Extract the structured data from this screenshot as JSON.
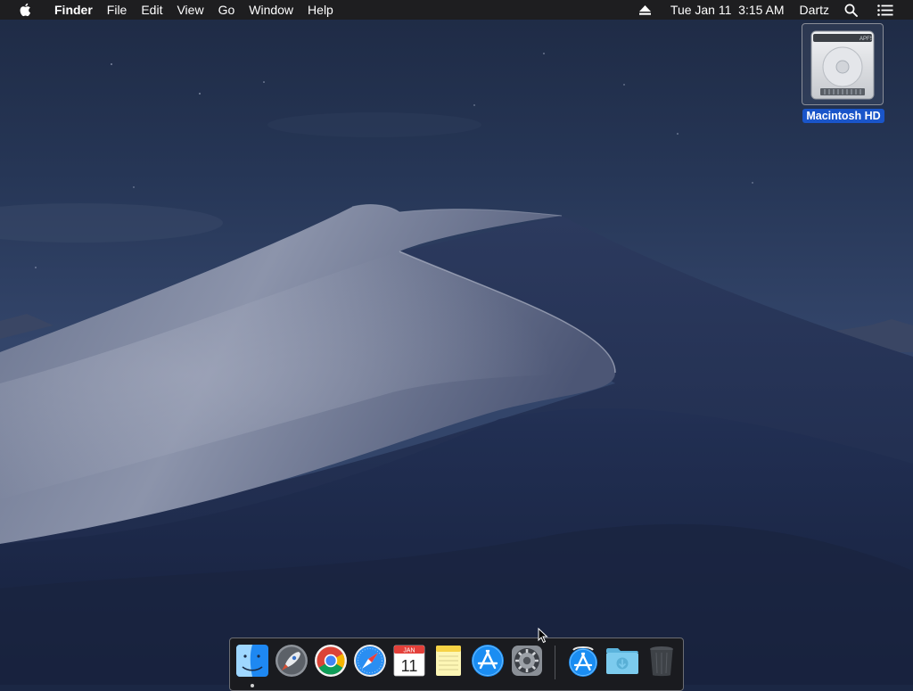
{
  "menubar": {
    "apple_icon": "apple-logo-icon",
    "app_name": "Finder",
    "menus": [
      "File",
      "Edit",
      "View",
      "Go",
      "Window",
      "Help"
    ],
    "status": {
      "eject_icon": "eject-icon",
      "clock": "Tue Jan 11  3:15 AM",
      "user": "Dartz",
      "search_icon": "spotlight-search-icon",
      "notifications_icon": "notification-center-icon"
    }
  },
  "desktop": {
    "icons": [
      {
        "label": "Macintosh HD",
        "icon": "hard-drive-icon",
        "selected": true,
        "drive_text": "APFS"
      }
    ]
  },
  "dock": {
    "apps": [
      {
        "name": "Finder",
        "icon": "finder-icon",
        "running": true
      },
      {
        "name": "Launchpad",
        "icon": "launchpad-icon"
      },
      {
        "name": "Google Chrome",
        "icon": "chrome-icon"
      },
      {
        "name": "Safari",
        "icon": "safari-icon"
      },
      {
        "name": "Calendar",
        "icon": "calendar-icon",
        "month": "JAN",
        "day": "11"
      },
      {
        "name": "Notes",
        "icon": "notes-icon"
      },
      {
        "name": "App Store",
        "icon": "app-store-icon"
      },
      {
        "name": "System Preferences",
        "icon": "system-preferences-icon"
      }
    ],
    "stacks": [
      {
        "name": "Applications",
        "icon": "applications-stack-icon"
      },
      {
        "name": "Downloads",
        "icon": "downloads-folder-icon"
      },
      {
        "name": "Trash",
        "icon": "trash-icon"
      }
    ]
  },
  "colors": {
    "menubar": "#1e1e20",
    "selection": "#1a55c9",
    "sky_top": "#1d2840",
    "sky_bottom": "#3b4d70"
  }
}
